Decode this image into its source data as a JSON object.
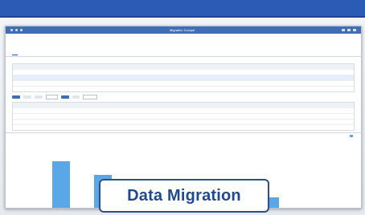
{
  "banner": {
    "title": "Data Migration"
  },
  "colors": {
    "top_bar": "#2a5bb5",
    "banner_border": "#2c4f8c",
    "banner_text": "#1d4a90",
    "bar": "#5aa7e8"
  },
  "screenshot": {
    "window_title": "Migration Cockpit",
    "header": {
      "object": "",
      "line1": "",
      "line2": ""
    },
    "tabs": [
      "",
      "",
      "",
      "",
      "",
      ""
    ],
    "bars": [
      0.74,
      0.53,
      0.44,
      0.35,
      0.26,
      0.18
    ]
  }
}
